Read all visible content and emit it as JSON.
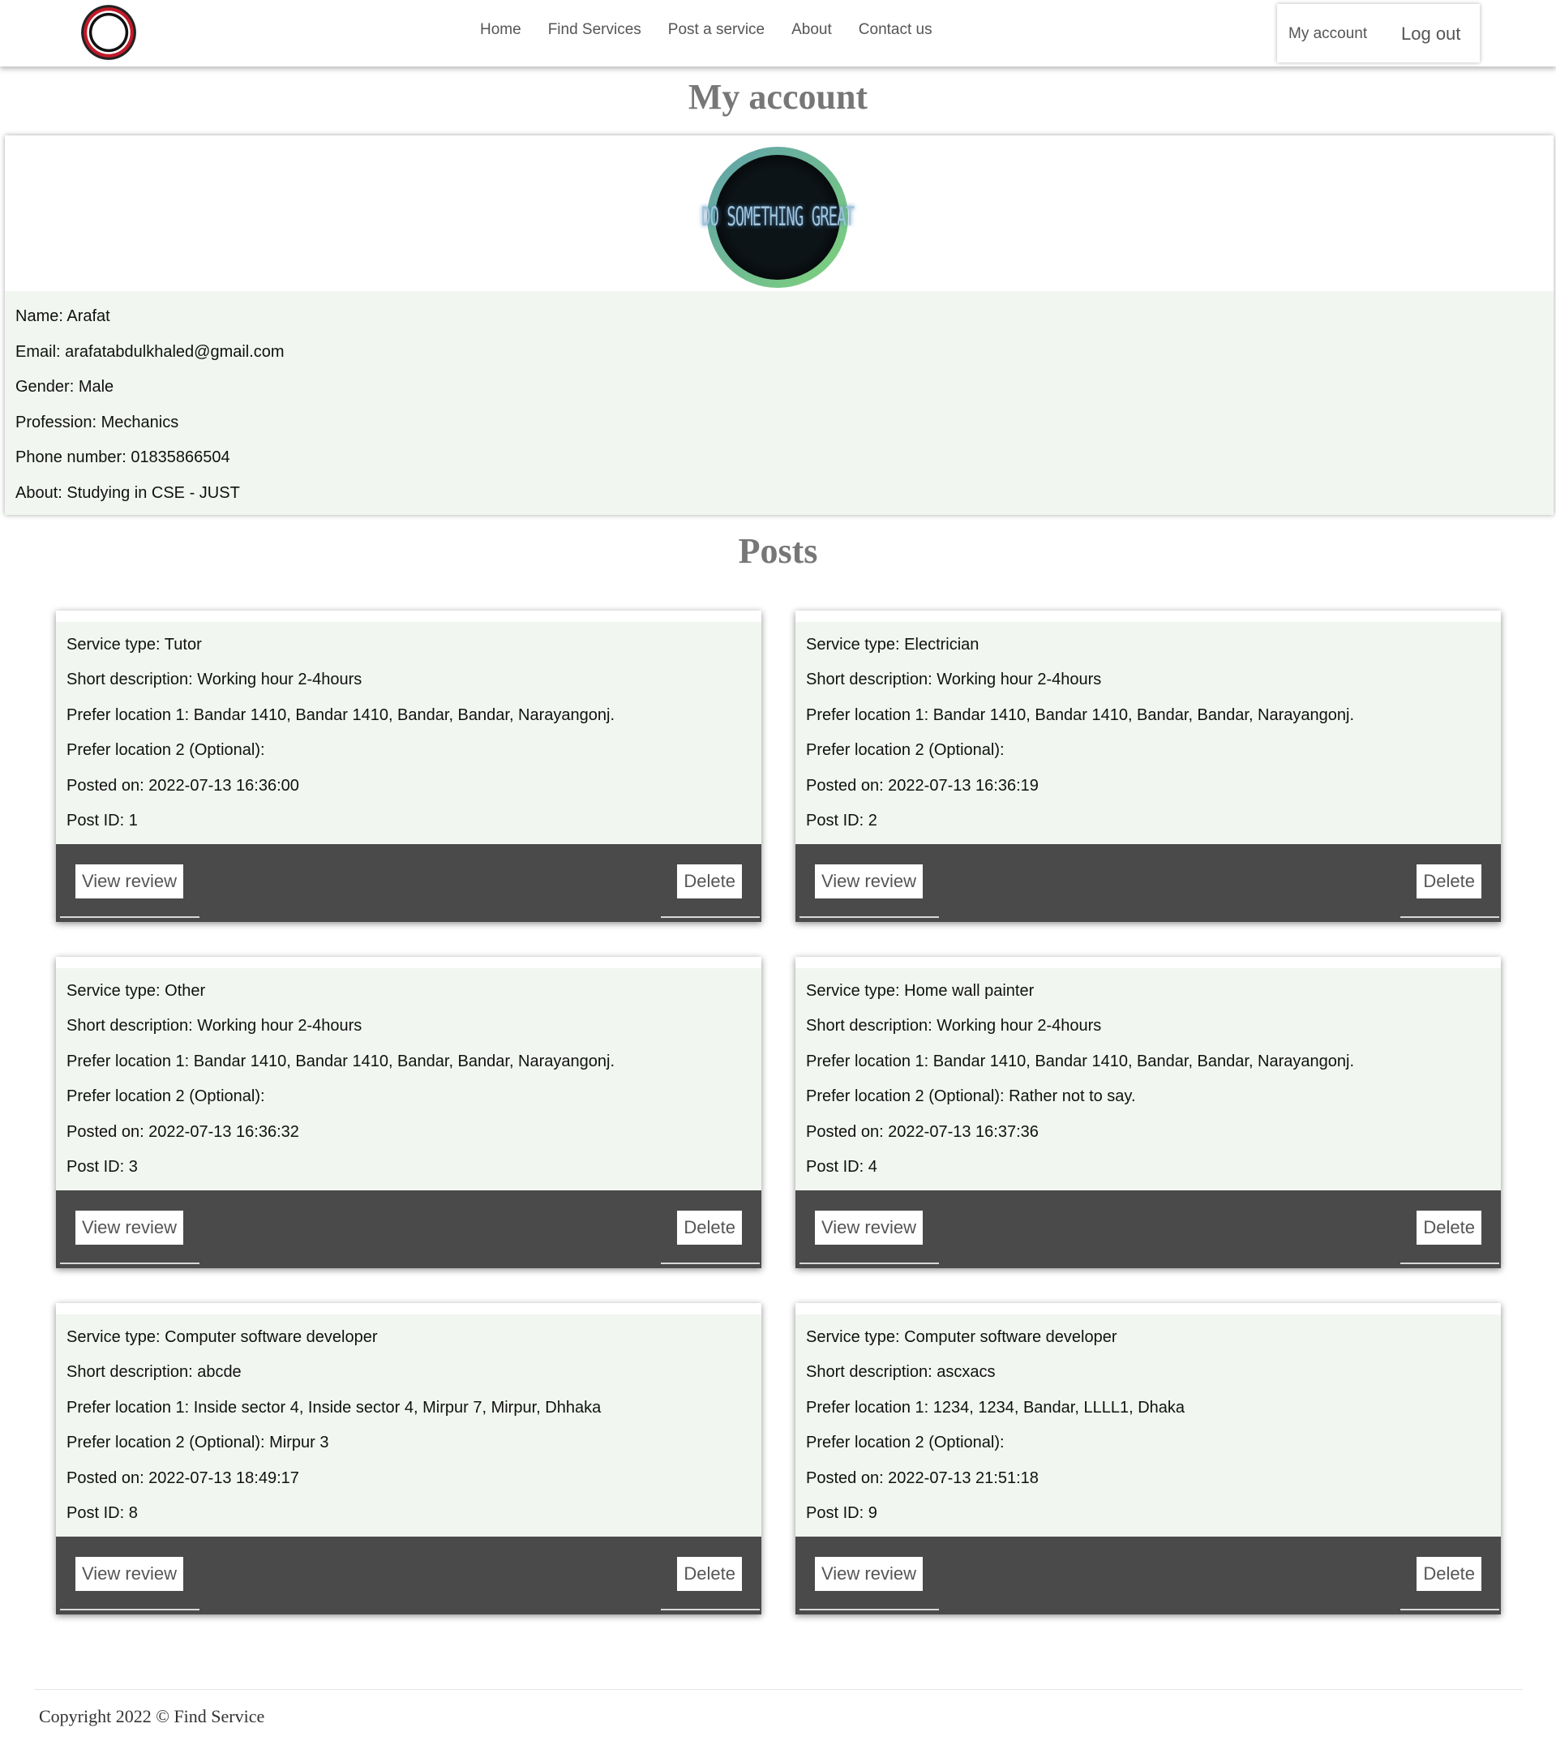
{
  "nav": {
    "links": [
      "Home",
      "Find Services",
      "Post a service",
      "About",
      "Contact us"
    ],
    "my_account": "My account",
    "log_out": "Log out"
  },
  "page_title": "My account",
  "profile": {
    "avatar_text": "DO SOMETHING GREAT",
    "rows": [
      "Name: Arafat",
      "Email: arafatabdulkhaled@gmail.com",
      "Gender: Male",
      "Profession: Mechanics",
      "Phone number: 01835866504",
      "About: Studying in CSE - JUST"
    ]
  },
  "posts_title": "Posts",
  "buttons": {
    "view_review": "View review",
    "delete": "Delete"
  },
  "posts": [
    {
      "rows": [
        "Service type: Tutor",
        "Short description: Working hour 2-4hours",
        "Prefer location 1: Bandar 1410, Bandar 1410, Bandar, Bandar, Narayangonj.",
        "Prefer location 2 (Optional):",
        "Posted on: 2022-07-13 16:36:00",
        "Post ID: 1"
      ]
    },
    {
      "rows": [
        "Service type: Electrician",
        "Short description: Working hour 2-4hours",
        "Prefer location 1: Bandar 1410, Bandar 1410, Bandar, Bandar, Narayangonj.",
        "Prefer location 2 (Optional):",
        "Posted on: 2022-07-13 16:36:19",
        "Post ID: 2"
      ]
    },
    {
      "rows": [
        "Service type: Other",
        "Short description: Working hour 2-4hours",
        "Prefer location 1: Bandar 1410, Bandar 1410, Bandar, Bandar, Narayangonj.",
        "Prefer location 2 (Optional):",
        "Posted on: 2022-07-13 16:36:32",
        "Post ID: 3"
      ]
    },
    {
      "rows": [
        "Service type: Home wall painter",
        "Short description: Working hour 2-4hours",
        "Prefer location 1: Bandar 1410, Bandar 1410, Bandar, Bandar, Narayangonj.",
        "Prefer location 2 (Optional): Rather not to say.",
        "Posted on: 2022-07-13 16:37:36",
        "Post ID: 4"
      ]
    },
    {
      "rows": [
        "Service type: Computer software developer",
        "Short description: abcde",
        "Prefer location 1: Inside sector 4, Inside sector 4, Mirpur 7, Mirpur, Dhhaka",
        "Prefer location 2 (Optional): Mirpur 3",
        "Posted on: 2022-07-13 18:49:17",
        "Post ID: 8"
      ]
    },
    {
      "rows": [
        "Service type: Computer software developer",
        "Short description: ascxacs",
        "Prefer location 1: 1234, 1234, Bandar, LLLL1, Dhaka",
        "Prefer location 2 (Optional):",
        "Posted on: 2022-07-13 21:51:18",
        "Post ID: 9"
      ]
    }
  ],
  "footer": {
    "copyright": "Copyright 2022 © Find Service"
  }
}
